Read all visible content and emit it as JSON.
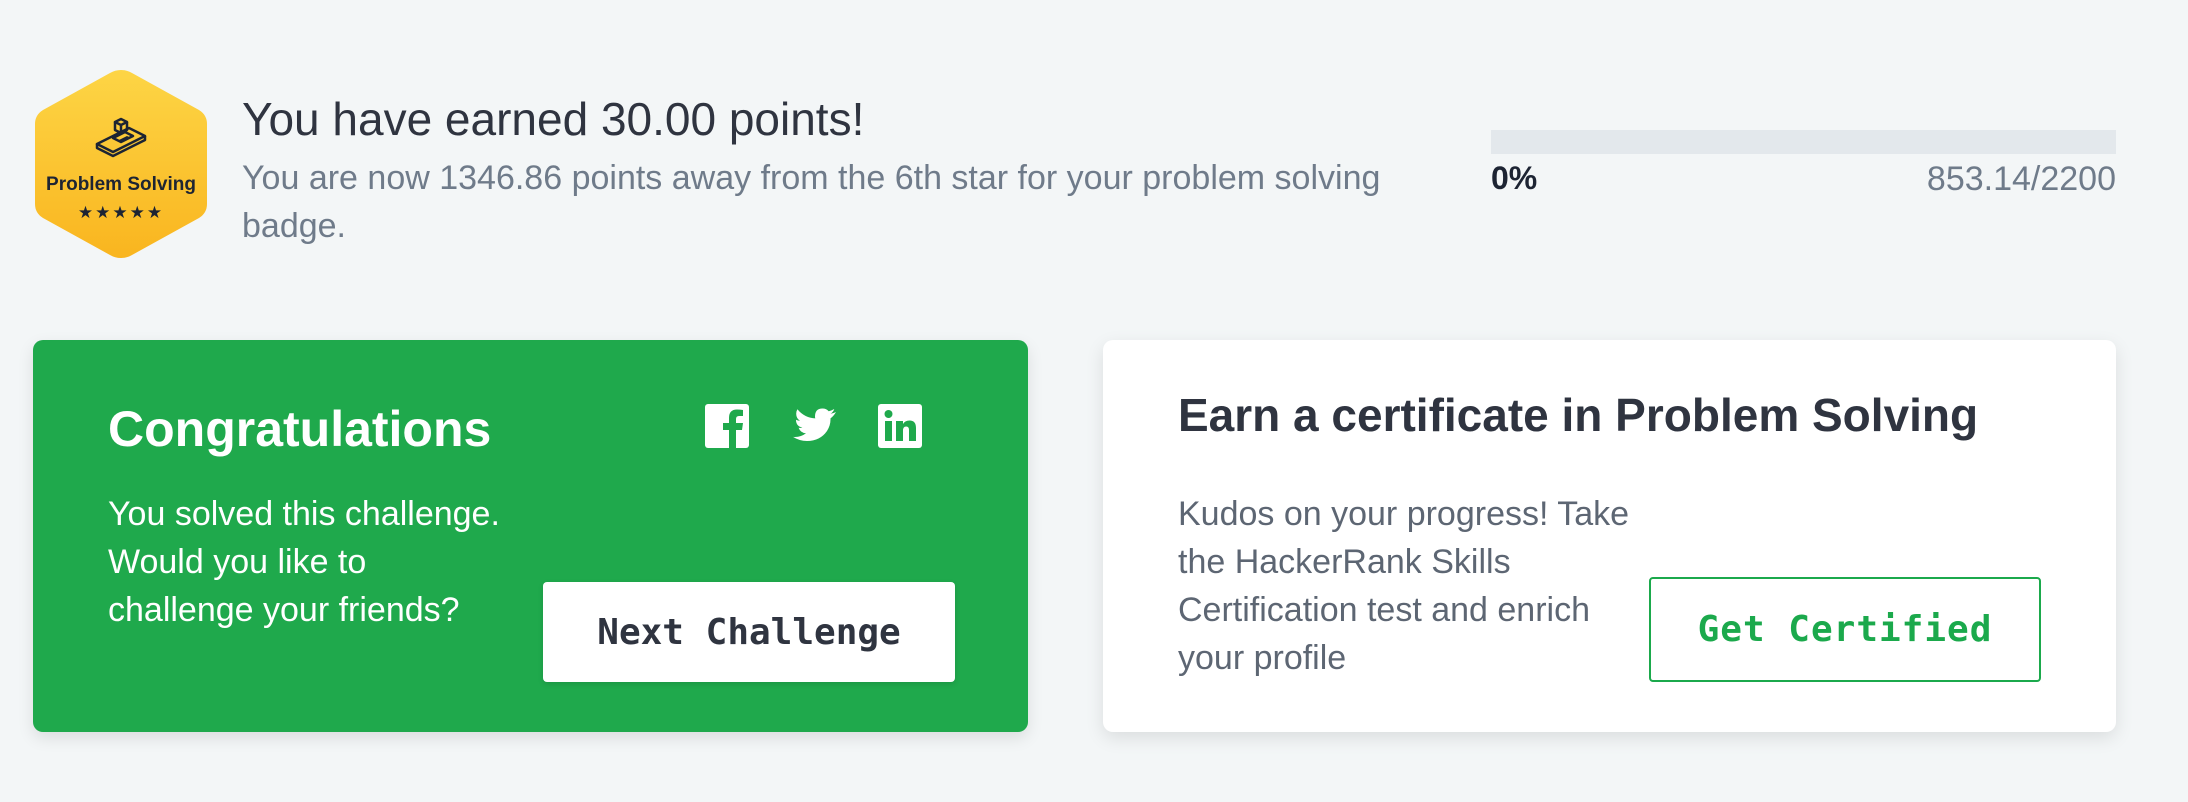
{
  "badge": {
    "label": "Problem Solving",
    "stars": "★★★★★",
    "icon": "blocks-icon",
    "color": "#fcc832"
  },
  "points": {
    "title": "You have earned 30.00 points!",
    "subtitle": "You are now 1346.86 points away from the 6th star for your problem solving badge."
  },
  "progress": {
    "percent_label": "0%",
    "percent_value": 0,
    "score": "853.14/2200"
  },
  "congrats_card": {
    "title": "Congratulations",
    "body": "You solved this challenge. Would you like to challenge your friends?",
    "next_button": "Next Challenge",
    "social_icons": [
      "facebook-icon",
      "twitter-icon",
      "linkedin-icon"
    ],
    "background": "#1fa94c"
  },
  "certificate_card": {
    "title": "Earn a certificate in Problem Solving",
    "body": "Kudos on your progress! Take the HackerRank Skills Certification test and enrich your profile",
    "button": "Get Certified",
    "accent": "#1ba94c"
  }
}
